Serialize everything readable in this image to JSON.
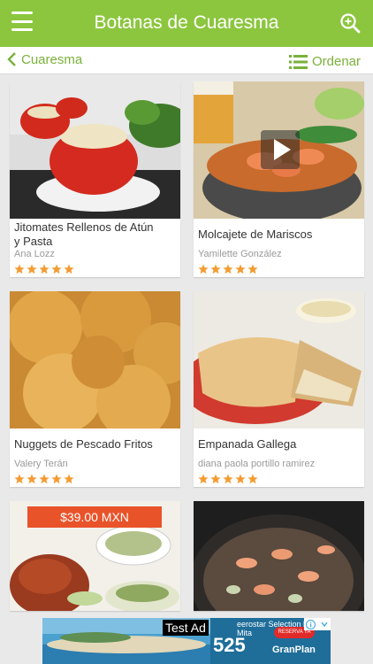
{
  "header": {
    "title": "Botanas de Cuaresma"
  },
  "subbar": {
    "back_label": "Cuaresma",
    "sort_label": "Ordenar"
  },
  "colors": {
    "brand": "#8cc63f",
    "accent": "#7ab13a",
    "star": "#f39c33",
    "price_tag": "#e9532a"
  },
  "recipes": [
    {
      "name": "Jitomates Rellenos de Atún y Pasta",
      "author": "Ana Lozz",
      "rating": 5
    },
    {
      "name": "Molcajete de Mariscos",
      "author": "Yamilette González",
      "rating": 5
    },
    {
      "name": "Nuggets de Pescado Fritos",
      "author": "Valery Terán",
      "rating": 5
    },
    {
      "name": "Empanada Gallega",
      "author": "diana paola portillo ramirez",
      "rating": 5
    },
    {
      "price_tag": "$39.00 MXN"
    }
  ],
  "ad": {
    "label": "Test Ad",
    "price": "525",
    "brand_top": "eerostar Selection laya Mita",
    "brand_bottom": "GranPlan",
    "cta": "RESERVA YA"
  }
}
